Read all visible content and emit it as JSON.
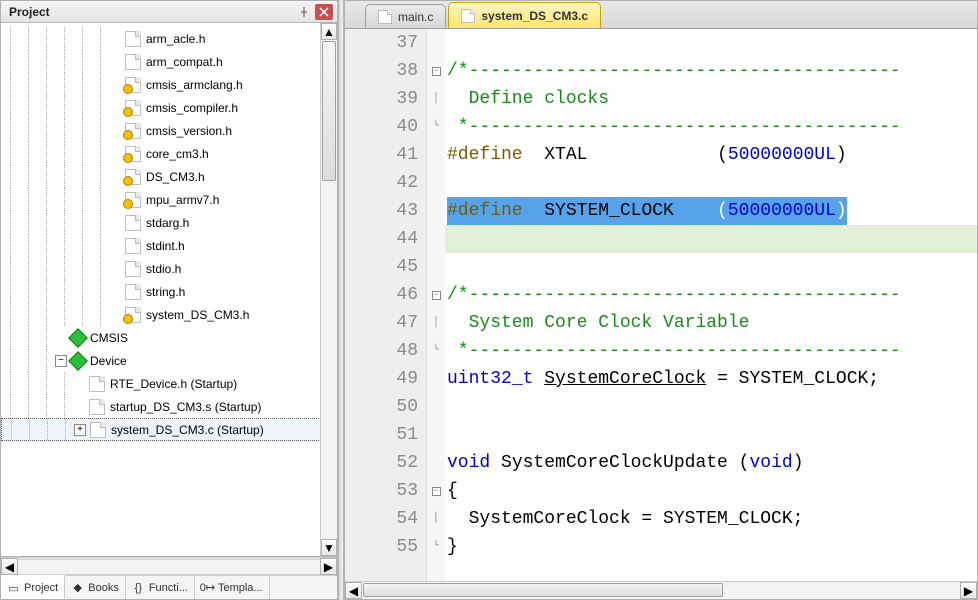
{
  "panel": {
    "title": "Project",
    "tree": {
      "files_level3": [
        {
          "label": "arm_acle.h",
          "icon": "file"
        },
        {
          "label": "arm_compat.h",
          "icon": "file"
        },
        {
          "label": "cmsis_armclang.h",
          "icon": "file-key"
        },
        {
          "label": "cmsis_compiler.h",
          "icon": "file-key"
        },
        {
          "label": "cmsis_version.h",
          "icon": "file-key"
        },
        {
          "label": "core_cm3.h",
          "icon": "file-key"
        },
        {
          "label": "DS_CM3.h",
          "icon": "file-key"
        },
        {
          "label": "mpu_armv7.h",
          "icon": "file-key"
        },
        {
          "label": "stdarg.h",
          "icon": "file"
        },
        {
          "label": "stdint.h",
          "icon": "file"
        },
        {
          "label": "stdio.h",
          "icon": "file"
        },
        {
          "label": "string.h",
          "icon": "file"
        },
        {
          "label": "system_DS_CM3.h",
          "icon": "file-key"
        }
      ],
      "group_cmsis": "CMSIS",
      "group_device": "Device",
      "device_children": [
        {
          "label": "RTE_Device.h (Startup)",
          "icon": "file",
          "expander": "none"
        },
        {
          "label": "startup_DS_CM3.s (Startup)",
          "icon": "file",
          "expander": "none"
        },
        {
          "label": "system_DS_CM3.c (Startup)",
          "icon": "file",
          "expander": "plus",
          "selected": true
        }
      ]
    },
    "bottom_tabs": [
      {
        "label": "Project",
        "icon": "project-icon",
        "active": true
      },
      {
        "label": "Books",
        "icon": "books-icon"
      },
      {
        "label": "Functi...",
        "icon": "braces-icon"
      },
      {
        "label": "Templa...",
        "icon": "template-icon"
      }
    ]
  },
  "editor": {
    "tabs": [
      {
        "label": "main.c",
        "active": false
      },
      {
        "label": "system_DS_CM3.c",
        "active": true
      }
    ],
    "first_line_number": 37,
    "lines": [
      {
        "n": 37,
        "fold": "",
        "html": ""
      },
      {
        "n": 38,
        "fold": "minus",
        "html": "<span class='c-comment'>/*----------------------------------------</span>"
      },
      {
        "n": 39,
        "fold": "bar",
        "html": "<span class='c-comment'>  Define clocks</span>"
      },
      {
        "n": 40,
        "fold": "end",
        "html": "<span class='c-comment'> *----------------------------------------</span>"
      },
      {
        "n": 41,
        "fold": "",
        "html": "<span class='c-pp'>#define</span>  <span class='c-ident'>XTAL</span>            (<span class='c-num'>50000000UL</span>)"
      },
      {
        "n": 42,
        "fold": "",
        "html": ""
      },
      {
        "n": 43,
        "fold": "",
        "sel": true,
        "html": "<span class='c-pp'>#define</span>  <span class='c-ident'>SYSTEM_CLOCK</span>    (<span class='c-num'>50000000UL</span>)"
      },
      {
        "n": 44,
        "fold": "",
        "cursor": true,
        "html": ""
      },
      {
        "n": 45,
        "fold": "",
        "html": ""
      },
      {
        "n": 46,
        "fold": "minus",
        "html": "<span class='c-comment'>/*----------------------------------------</span>"
      },
      {
        "n": 47,
        "fold": "bar",
        "html": "<span class='c-comment'>  System Core Clock Variable</span>"
      },
      {
        "n": 48,
        "fold": "end",
        "html": "<span class='c-comment'> *----------------------------------------</span>"
      },
      {
        "n": 49,
        "fold": "",
        "html": "<span class='c-keyword'>uint32_t</span> <u>SystemCoreClock</u> = SYSTEM_CLOCK;"
      },
      {
        "n": 50,
        "fold": "",
        "html": ""
      },
      {
        "n": 51,
        "fold": "",
        "html": ""
      },
      {
        "n": 52,
        "fold": "",
        "html": "<span class='c-keyword'>void</span> SystemCoreClockUpdate (<span class='c-keyword'>void</span>)"
      },
      {
        "n": 53,
        "fold": "minus",
        "html": "{"
      },
      {
        "n": 54,
        "fold": "bar",
        "html": "  SystemCoreClock = SYSTEM_CLOCK;"
      },
      {
        "n": 55,
        "fold": "end",
        "html": "}"
      }
    ]
  }
}
